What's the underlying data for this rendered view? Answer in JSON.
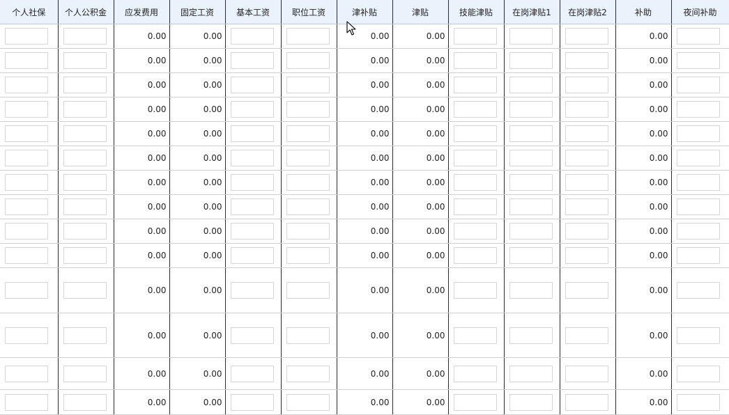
{
  "columns": [
    {
      "label": "个人社保",
      "kind": "input"
    },
    {
      "label": "个人公积金",
      "kind": "input"
    },
    {
      "label": "应发费用",
      "kind": "num"
    },
    {
      "label": "固定工资",
      "kind": "num"
    },
    {
      "label": "基本工资",
      "kind": "input"
    },
    {
      "label": "职位工资",
      "kind": "input"
    },
    {
      "label": "津补贴",
      "kind": "num"
    },
    {
      "label": "津贴",
      "kind": "num"
    },
    {
      "label": "技能津贴",
      "kind": "input"
    },
    {
      "label": "在岗津贴1",
      "kind": "input"
    },
    {
      "label": "在岗津贴2",
      "kind": "input"
    },
    {
      "label": "补助",
      "kind": "num"
    },
    {
      "label": "夜间补助",
      "kind": "input"
    }
  ],
  "rows": [
    {
      "应发费用": "0.00",
      "固定工资": "0.00",
      "津补贴": "0.00",
      "津贴": "0.00",
      "补助": "0.00"
    },
    {
      "应发费用": "0.00",
      "固定工资": "0.00",
      "津补贴": "0.00",
      "津贴": "0.00",
      "补助": "0.00"
    },
    {
      "应发费用": "0.00",
      "固定工资": "0.00",
      "津补贴": "0.00",
      "津贴": "0.00",
      "补助": "0.00"
    },
    {
      "应发费用": "0.00",
      "固定工资": "0.00",
      "津补贴": "0.00",
      "津贴": "0.00",
      "补助": "0.00"
    },
    {
      "应发费用": "0.00",
      "固定工资": "0.00",
      "津补贴": "0.00",
      "津贴": "0.00",
      "补助": "0.00"
    },
    {
      "应发费用": "0.00",
      "固定工资": "0.00",
      "津补贴": "0.00",
      "津贴": "0.00",
      "补助": "0.00"
    },
    {
      "应发费用": "0.00",
      "固定工资": "0.00",
      "津补贴": "0.00",
      "津贴": "0.00",
      "补助": "0.00"
    },
    {
      "应发费用": "0.00",
      "固定工资": "0.00",
      "津补贴": "0.00",
      "津贴": "0.00",
      "补助": "0.00"
    },
    {
      "应发费用": "0.00",
      "固定工资": "0.00",
      "津补贴": "0.00",
      "津贴": "0.00",
      "补助": "0.00"
    },
    {
      "应发费用": "0.00",
      "固定工资": "0.00",
      "津补贴": "0.00",
      "津贴": "0.00",
      "补助": "0.00"
    },
    {
      "应发费用": "0.00",
      "固定工资": "0.00",
      "津补贴": "0.00",
      "津贴": "0.00",
      "补助": "0.00"
    },
    {
      "应发费用": "0.00",
      "固定工资": "0.00",
      "津补贴": "0.00",
      "津贴": "0.00",
      "补助": "0.00"
    },
    {
      "应发费用": "0.00",
      "固定工资": "0.00",
      "津补贴": "0.00",
      "津贴": "0.00",
      "补助": "0.00"
    },
    {
      "应发费用": "0.00",
      "固定工资": "0.00",
      "津补贴": "0.00",
      "津贴": "0.00",
      "补助": "0.00"
    }
  ],
  "icons": {
    "cursor": "mouse-pointer-icon"
  },
  "colors": {
    "header_bg": "#eaf3fc",
    "column_border": "#2a2a2a",
    "input_border": "#d5d5d5"
  }
}
